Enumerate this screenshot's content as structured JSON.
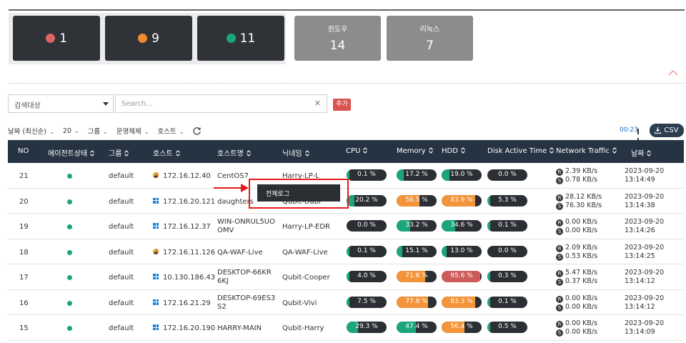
{
  "status_cards": [
    {
      "count": "1",
      "color": "#e06464"
    },
    {
      "count": "9",
      "color": "#f08a2e"
    },
    {
      "count": "11",
      "color": "#1aa67a"
    }
  ],
  "os_cards": [
    {
      "label": "윈도우",
      "count": "14"
    },
    {
      "label": "리눅스",
      "count": "7"
    }
  ],
  "search": {
    "target_label": "검색대상",
    "placeholder": "Search...",
    "clear": "✕",
    "add_label": "추가"
  },
  "filters": [
    "날짜 (최신순)",
    "20",
    "그룹",
    "운영체제",
    "호스트"
  ],
  "timer": "00:23",
  "csv_label": "CSV",
  "columns": [
    "NO",
    "에이전트상태",
    "그룹",
    "호스트",
    "호스트명",
    "닉네임",
    "CPU",
    "Memory",
    "HDD",
    "Disk Active Time",
    "Network Traffic",
    "날짜"
  ],
  "rows": [
    {
      "no": "21",
      "group": "default",
      "os": "linux",
      "host": "172.16.12.40",
      "hostname": "CentOS7",
      "nickname": "Harry-LP-L",
      "cpu": {
        "text": "0.1 %",
        "value": 0.1
      },
      "memory": {
        "text": "17.2 %",
        "value": 17.2
      },
      "hdd": {
        "text": "19.0 %",
        "value": 19.0
      },
      "disk": {
        "text": "0.0 %",
        "value": 0.0
      },
      "recv": "2.39 KB/s",
      "send": "0.78 KB/s",
      "date": "2023-09-20",
      "time": "13:14:49"
    },
    {
      "no": "20",
      "group": "default",
      "os": "windows",
      "host": "172.16.20.121",
      "hostname": "daughters",
      "nickname": "Qubit-Dabi",
      "cpu": {
        "text": "20.2 %",
        "value": 20.2
      },
      "memory": {
        "text": "56.5 %",
        "value": 56.5
      },
      "hdd": {
        "text": "83.9 %",
        "value": 83.9
      },
      "disk": {
        "text": "5.3 %",
        "value": 5.3
      },
      "recv": "28.12 KB/s",
      "send": "76.30 KB/s",
      "date": "2023-09-20",
      "time": "13:14:38"
    },
    {
      "no": "19",
      "group": "default",
      "os": "windows",
      "host": "172.16.12.37",
      "hostname": "WIN-ONRUL5UOOMV",
      "nickname": "Harry-LP-EDR",
      "cpu": {
        "text": "0.0 %",
        "value": 0.0
      },
      "memory": {
        "text": "33.2 %",
        "value": 33.2
      },
      "hdd": {
        "text": "34.6 %",
        "value": 34.6
      },
      "disk": {
        "text": "0.1 %",
        "value": 0.1
      },
      "recv": "0.00 KB/s",
      "send": "0.00 KB/s",
      "date": "2023-09-20",
      "time": "13:14:26"
    },
    {
      "no": "18",
      "group": "default",
      "os": "linux",
      "host": "172.16.11.126",
      "hostname": "QA-WAF-Live",
      "nickname": "QA-WAF-Live",
      "cpu": {
        "text": "0.1 %",
        "value": 0.1
      },
      "memory": {
        "text": "15.1 %",
        "value": 15.1
      },
      "hdd": {
        "text": "13.0 %",
        "value": 13.0
      },
      "disk": {
        "text": "0.0 %",
        "value": 0.0
      },
      "recv": "2.09 KB/s",
      "send": "0.53 KB/s",
      "date": "2023-09-20",
      "time": "13:14:25"
    },
    {
      "no": "17",
      "group": "default",
      "os": "windows",
      "host": "10.130.186.43",
      "hostname": "DESKTOP-66KR6KJ",
      "nickname": "Qubit-Cooper",
      "cpu": {
        "text": "4.0 %",
        "value": 4.0
      },
      "memory": {
        "text": "71.6 %",
        "value": 71.6
      },
      "hdd": {
        "text": "95.6 %",
        "value": 95.6
      },
      "disk": {
        "text": "0.3 %",
        "value": 0.3
      },
      "recv": "5.47 KB/s",
      "send": "0.37 KB/s",
      "date": "2023-09-20",
      "time": "13:14:12"
    },
    {
      "no": "16",
      "group": "default",
      "os": "windows",
      "host": "172.16.21.29",
      "hostname": "DESKTOP-69ES3S2",
      "nickname": "Qubit-Vivi",
      "cpu": {
        "text": "7.5 %",
        "value": 7.5
      },
      "memory": {
        "text": "77.8 %",
        "value": 77.8
      },
      "hdd": {
        "text": "83.3 %",
        "value": 83.3
      },
      "disk": {
        "text": "0.1 %",
        "value": 0.1
      },
      "recv": "0.00 KB/s",
      "send": "0.00 KB/s",
      "date": "2023-09-20",
      "time": "13:14:12"
    },
    {
      "no": "15",
      "group": "default",
      "os": "windows",
      "host": "172.16.20.190",
      "hostname": "HARRY-MAIN",
      "nickname": "Qubit-Harry",
      "cpu": {
        "text": "29.3 %",
        "value": 29.3
      },
      "memory": {
        "text": "47.4 %",
        "value": 47.4
      },
      "hdd": {
        "text": "56.4 %",
        "value": 56.4
      },
      "disk": {
        "text": "0.5 %",
        "value": 0.5
      },
      "recv": "0.00 KB/s",
      "send": "0.00 KB/s",
      "date": "2023-09-20",
      "time": "13:14:09"
    }
  ],
  "traffic_tags": {
    "recv": "R",
    "send": "S"
  },
  "context_menu": {
    "item": "전체로그"
  },
  "colors": {
    "green": "#1aa67a",
    "orange": "#f3943a",
    "red": "#cf5a5a",
    "header": "#253342",
    "highlight": "#e41b1b"
  }
}
